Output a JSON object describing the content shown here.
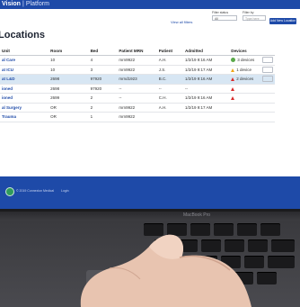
{
  "header": {
    "brand": "Vision",
    "separator": "|",
    "product": "Platform"
  },
  "page": {
    "title": "Locations"
  },
  "filters": {
    "view_all": "View all filters",
    "filter_status_label": "Filter status",
    "filter_status_value": "All",
    "filter_by_label": "Filter by",
    "filter_by_placeholder": "Type here",
    "primary_button": "Add New Location"
  },
  "table": {
    "columns": [
      "Unit",
      "Room",
      "Bed",
      "Patient MRN",
      "Patient",
      "Admitted",
      "Devices",
      ""
    ],
    "rows": [
      {
        "unit": "al Care",
        "room": "10",
        "bed": "4",
        "mrn": "mrn9922",
        "patient": "A.H.",
        "admitted": "1/2/19 9:16 AM",
        "device_status": "ok",
        "devices": "3 devices",
        "highlight": false
      },
      {
        "unit": "at ICU",
        "room": "10",
        "bed": "3",
        "mrn": "mrn9922",
        "patient": "J.S.",
        "admitted": "1/2/19 9:17 AM",
        "device_status": "warn",
        "devices": "1 device",
        "highlight": false
      },
      {
        "unit": "at L&D",
        "room": "2698",
        "bed": "97920",
        "mrn": "mrnd1923",
        "patient": "B.C.",
        "admitted": "1/2/19 9:16 AM",
        "device_status": "alarm",
        "devices": "2 devices",
        "highlight": true
      },
      {
        "unit": "ioned",
        "room": "2698",
        "bed": "97920",
        "mrn": "--",
        "patient": "--",
        "admitted": "--",
        "device_status": "alarm",
        "devices": "",
        "highlight": false
      },
      {
        "unit": "ioned",
        "room": "2699",
        "bed": "2",
        "mrn": "--",
        "patient": "C.H.",
        "admitted": "1/2/19 9:16 AM",
        "device_status": "alarm",
        "devices": "",
        "highlight": false
      },
      {
        "unit": "al Surgery",
        "room": "OR",
        "bed": "2",
        "mrn": "mrn9922",
        "patient": "A.H.",
        "admitted": "1/2/19 9:17 AM",
        "device_status": "none",
        "devices": "",
        "highlight": false
      },
      {
        "unit": "Trauma",
        "room": "OR",
        "bed": "1",
        "mrn": "mrn9922",
        "patient": "",
        "admitted": "",
        "device_status": "none",
        "devices": "",
        "highlight": false
      }
    ]
  },
  "footer": {
    "company": "© 2019 Connexion Medical",
    "link": "Login"
  },
  "laptop": {
    "model_label": "MacBook Pro"
  },
  "colors": {
    "primary": "#1e4aa8",
    "highlight_row": "#d7e6f3",
    "alarm": "#d82b2b",
    "warn": "#f0a81c",
    "ok": "#5aa84a"
  }
}
